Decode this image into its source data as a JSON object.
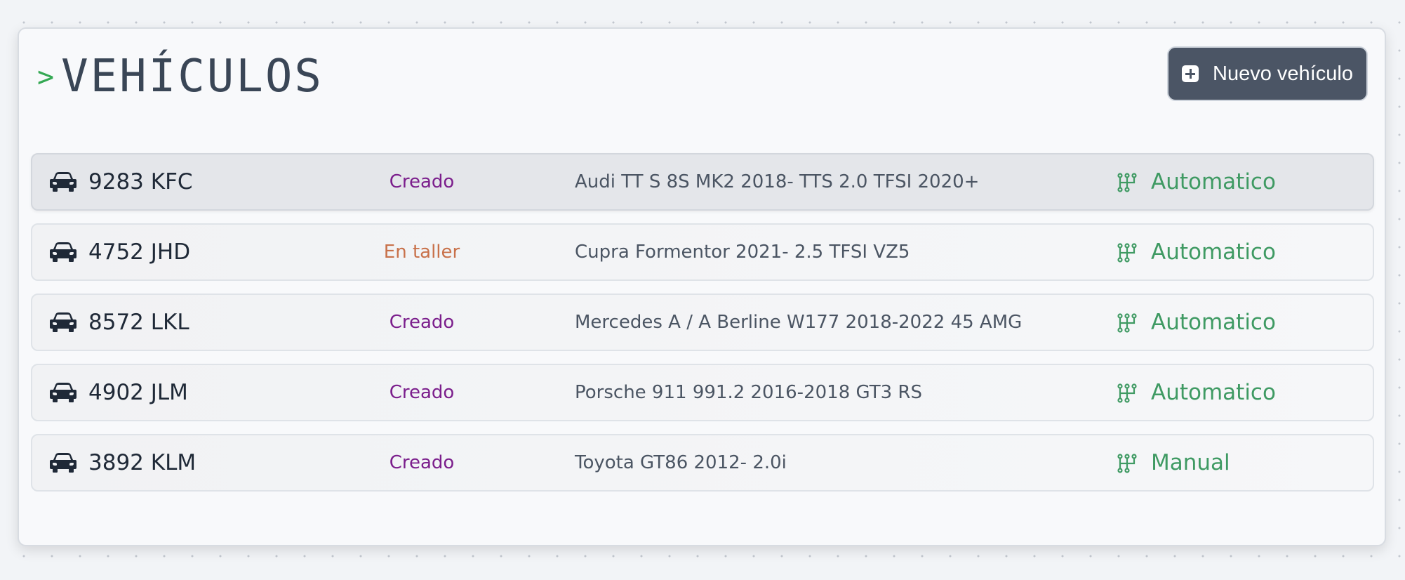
{
  "header": {
    "prompt_symbol": ">",
    "title": "VEHÍCULOS",
    "new_button_label": "Nuevo vehículo"
  },
  "colors": {
    "accent_green": "#3f9a63",
    "prompt_green": "#34a853",
    "status_creado": "#7b1e8c",
    "status_en_taller": "#c8714a",
    "button_bg": "#4b5565"
  },
  "icons": {
    "vehicle": "car-icon",
    "transmission": "gear-shift-icon",
    "new": "plus-square-icon"
  },
  "vehicles": [
    {
      "plate": "9283 KFC",
      "status": "Creado",
      "status_color": "#7b1e8c",
      "model": "Audi TT S 8S MK2 2018- TTS 2.0 TFSI 2020+",
      "transmission": "Automatico",
      "selected": true
    },
    {
      "plate": "4752 JHD",
      "status": "En taller",
      "status_color": "#c8714a",
      "model": "Cupra Formentor 2021- 2.5 TFSI VZ5",
      "transmission": "Automatico",
      "selected": false
    },
    {
      "plate": "8572 LKL",
      "status": "Creado",
      "status_color": "#7b1e8c",
      "model": "Mercedes A / A Berline W177 2018-2022 45 AMG",
      "transmission": "Automatico",
      "selected": false
    },
    {
      "plate": "4902 JLM",
      "status": "Creado",
      "status_color": "#7b1e8c",
      "model": "Porsche 911 991.2 2016-2018 GT3 RS",
      "transmission": "Automatico",
      "selected": false
    },
    {
      "plate": "3892 KLM",
      "status": "Creado",
      "status_color": "#7b1e8c",
      "model": "Toyota GT86 2012- 2.0i",
      "transmission": "Manual",
      "selected": false
    }
  ]
}
